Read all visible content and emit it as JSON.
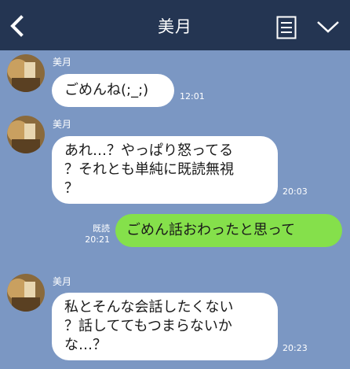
{
  "header": {
    "title": "美月",
    "back_icon": "chevron-left-icon",
    "menu_icon": "notes-menu-icon",
    "expand_icon": "chevron-down-icon"
  },
  "colors": {
    "header_bg": "#243552",
    "chat_bg": "#7b97c3",
    "incoming_bubble": "#ffffff",
    "outgoing_bubble": "#85e04b"
  },
  "messages": [
    {
      "sender": "美月",
      "text": "ごめんね(;_;)",
      "time": "12:01",
      "direction": "incoming"
    },
    {
      "sender": "美月",
      "lines": [
        "あれ…？やっぱり怒ってる",
        "？それとも単純に既読無視",
        "？"
      ],
      "time": "20:03",
      "direction": "incoming"
    },
    {
      "text": "ごめん話おわったと思って",
      "read_label": "既読",
      "time": "20:21",
      "direction": "outgoing"
    },
    {
      "sender": "美月",
      "lines": [
        "私とそんな会話したくない",
        "？話しててもつまらないか",
        "な…？"
      ],
      "time": "20:23",
      "direction": "incoming"
    }
  ]
}
